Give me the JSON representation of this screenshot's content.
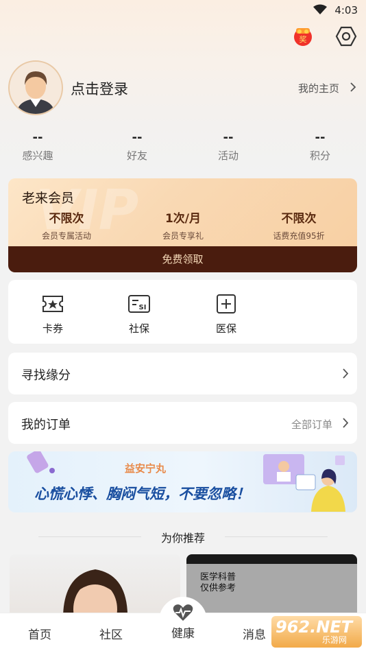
{
  "status_bar": {
    "time": "4:03"
  },
  "profile": {
    "login_text": "点击登录",
    "my_home_label": "我的主页"
  },
  "stats": [
    {
      "value": "--",
      "label": "感兴趣"
    },
    {
      "value": "--",
      "label": "好友"
    },
    {
      "value": "--",
      "label": "活动"
    },
    {
      "value": "--",
      "label": "积分"
    }
  ],
  "vip": {
    "title": "老来会员",
    "benefits": [
      {
        "value": "不限次",
        "desc": "会员专属活动"
      },
      {
        "value": "1次/月",
        "desc": "会员专享礼"
      },
      {
        "value": "不限次",
        "desc": "话费充值95折"
      }
    ],
    "claim_label": "免费领取"
  },
  "services": [
    {
      "label": "卡券",
      "icon": "coupon-icon"
    },
    {
      "label": "社保",
      "icon": "social-security-icon"
    },
    {
      "label": "医保",
      "icon": "medical-insurance-icon"
    }
  ],
  "find_fate": {
    "label": "寻找缘分"
  },
  "orders": {
    "label": "我的订单",
    "all_label": "全部订单"
  },
  "banner": {
    "brand": "益安宁丸",
    "headline": "心慌心悸、胸闷气短，不要忽略！"
  },
  "recommend": {
    "title": "为你推荐",
    "video_caption_1": "医学科普",
    "video_caption_2": "仅供参考"
  },
  "tabbar": {
    "tabs": [
      "首页",
      "社区",
      "健康",
      "消息"
    ]
  },
  "watermark": {
    "brand": "962.NET",
    "sub": "乐游网"
  },
  "colors": {
    "vip_dark": "#4a1c0e",
    "vip_gold": "#f5d9b8",
    "banner_blue": "#1a4fa0"
  }
}
